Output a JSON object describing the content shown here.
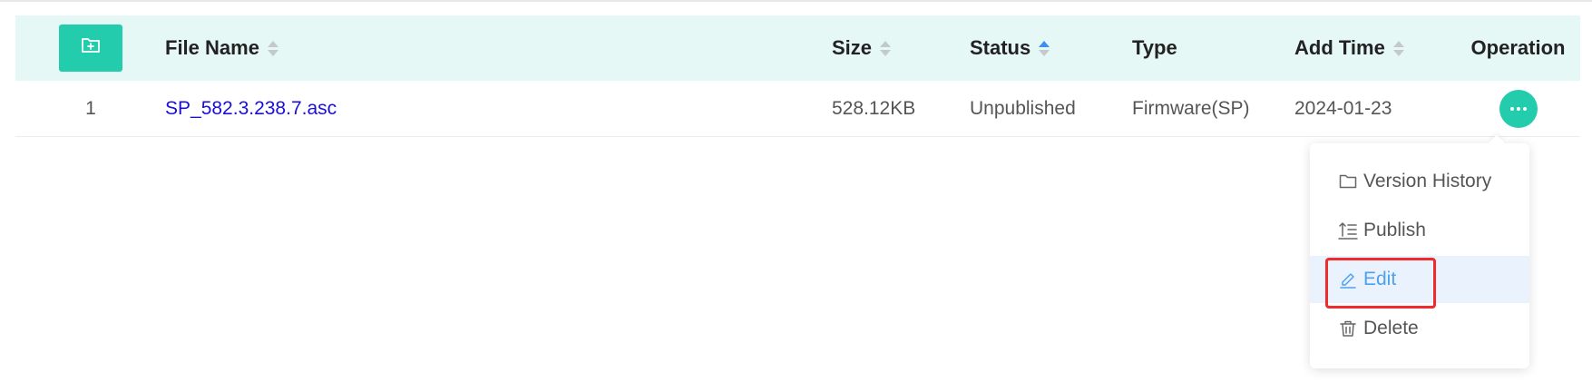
{
  "table": {
    "columns": {
      "name": "File Name",
      "size": "Size",
      "status": "Status",
      "type": "Type",
      "add_time": "Add Time",
      "operation": "Operation"
    },
    "sort_state": {
      "status": "ascending"
    },
    "rows": [
      {
        "index": "1",
        "name": "SP_582.3.238.7.asc",
        "size": "528.12KB",
        "status": "Unpublished",
        "type": "Firmware(SP)",
        "add_time": "2024-01-23"
      }
    ]
  },
  "operation_menu": {
    "items": [
      {
        "label": "Version History",
        "icon": "folder-icon"
      },
      {
        "label": "Publish",
        "icon": "publish-icon"
      },
      {
        "label": "Edit",
        "icon": "pencil-icon",
        "highlighted": true
      },
      {
        "label": "Delete",
        "icon": "trash-icon"
      }
    ]
  },
  "colors": {
    "accent": "#22ccad",
    "header_bg": "#e6f8f5",
    "link": "#1a0fd6",
    "menu_active_text": "#4ea1ee",
    "menu_active_bg": "#eaf3fd",
    "highlight_border": "#ef2b2b",
    "sort_active": "#3b8ff0"
  }
}
